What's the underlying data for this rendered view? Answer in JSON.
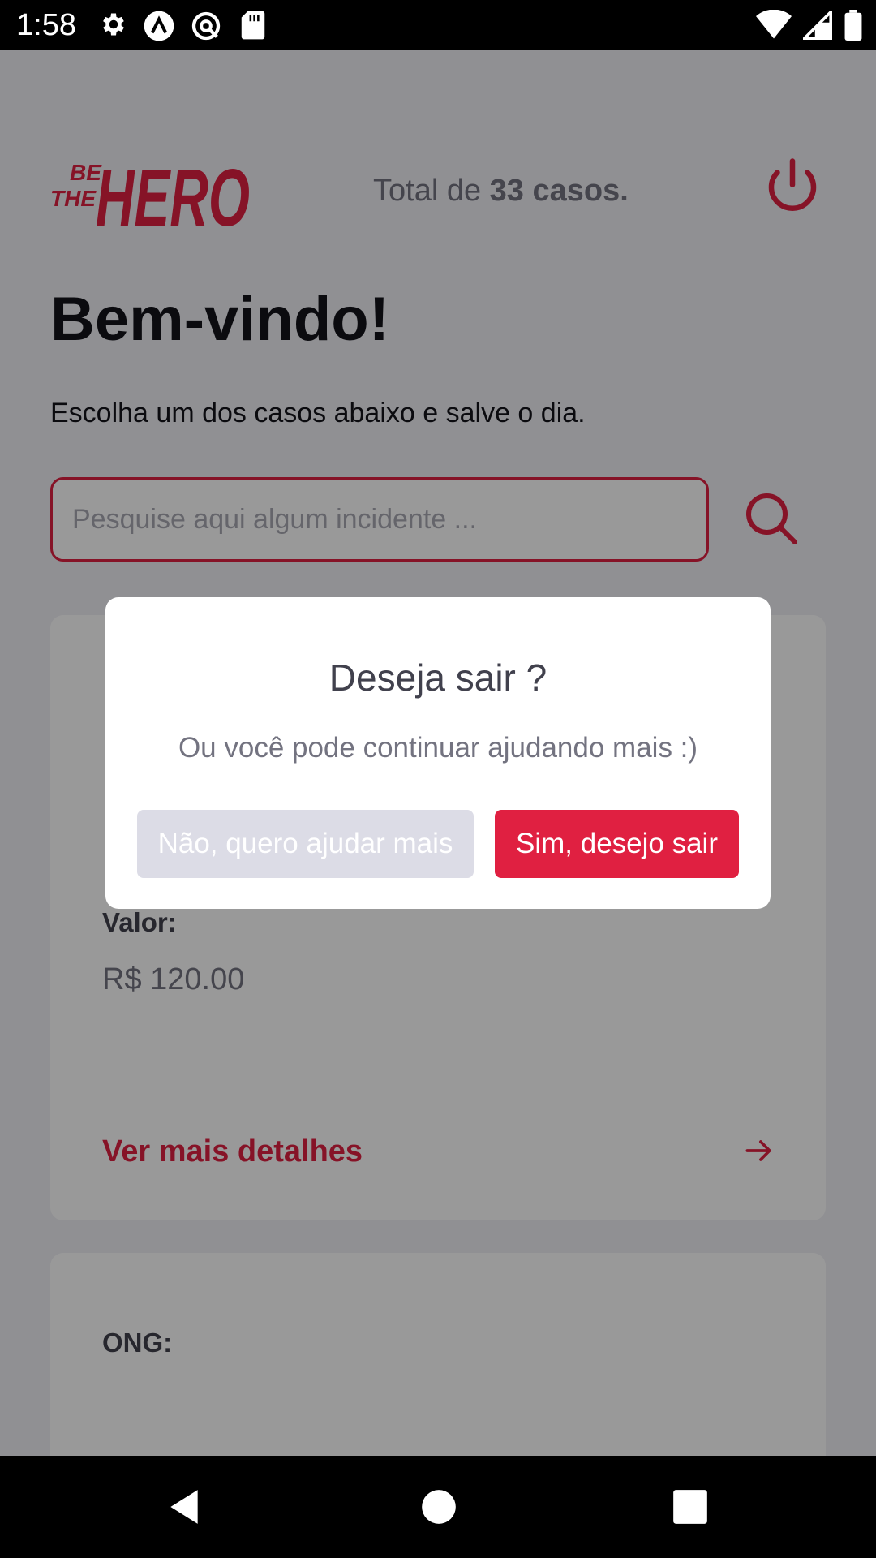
{
  "status_bar": {
    "time": "1:58",
    "icons_left": [
      "settings-icon",
      "app-icon",
      "at-icon",
      "sd-card-icon"
    ],
    "icons_right": [
      "wifi-icon",
      "signal-icon",
      "battery-icon"
    ]
  },
  "header": {
    "logo_small_line1": "BE",
    "logo_small_line2": "THE",
    "logo_big": "HERO",
    "total_prefix": "Total de",
    "total_count": "33 casos.",
    "power_icon": "power-icon"
  },
  "main": {
    "title": "Bem-vindo!",
    "subtitle": "Escolha um dos casos abaixo e salve o dia."
  },
  "search": {
    "placeholder": "Pesquise aqui algum incidente ...",
    "value": "",
    "icon": "search-icon"
  },
  "cards": [
    {
      "value_label": "Valor:",
      "value": "R$ 120.00",
      "details_label": "Ver mais detalhes",
      "details_icon": "arrow-right-icon"
    },
    {
      "ong_label": "ONG:"
    }
  ],
  "modal": {
    "title": "Deseja sair ?",
    "message": "Ou você pode continuar ajudando mais :)",
    "cancel_label": "Não, quero ajudar mais",
    "confirm_label": "Sim, desejo sair"
  },
  "nav_bar": {
    "icons": [
      "back-icon",
      "home-icon",
      "recents-icon"
    ]
  },
  "colors": {
    "accent": "#E02041",
    "background": "#F0F0F5",
    "text": "#13131A",
    "muted": "#737380",
    "cancel_button": "#DCDCE6"
  }
}
